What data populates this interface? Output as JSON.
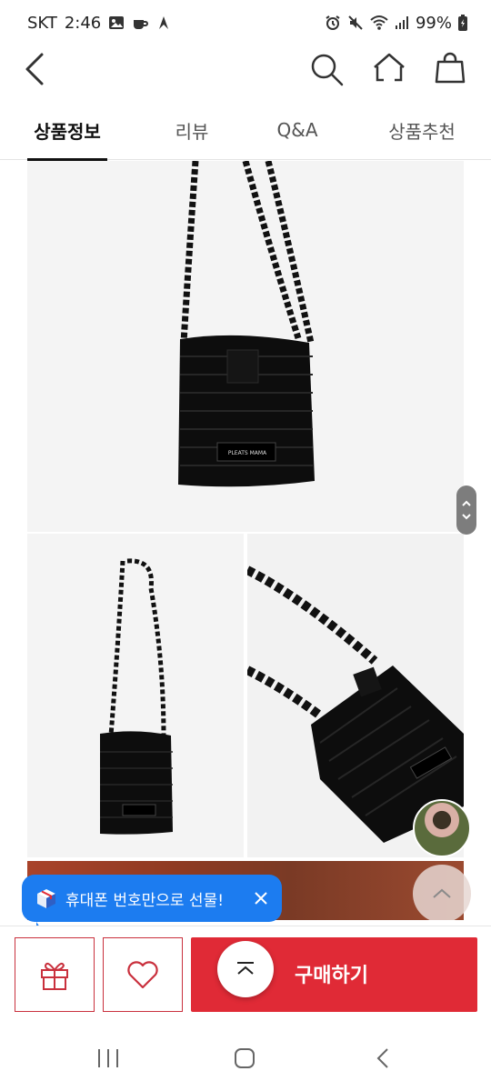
{
  "status_bar": {
    "carrier": "SKT",
    "time": "2:46",
    "battery": "99%"
  },
  "tabs": [
    {
      "label": "상품정보",
      "active": true
    },
    {
      "label": "리뷰",
      "active": false
    },
    {
      "label": "Q&A",
      "active": false
    },
    {
      "label": "상품추천",
      "active": false
    }
  ],
  "product_images": {
    "label_text": "PLEATS MAMA"
  },
  "tooltip": {
    "text": "휴대폰 번호만으로 선물!"
  },
  "action_bar": {
    "buy_label": "구매하기"
  },
  "colors": {
    "accent": "#e02a36",
    "tooltip": "#1c7cf0"
  }
}
